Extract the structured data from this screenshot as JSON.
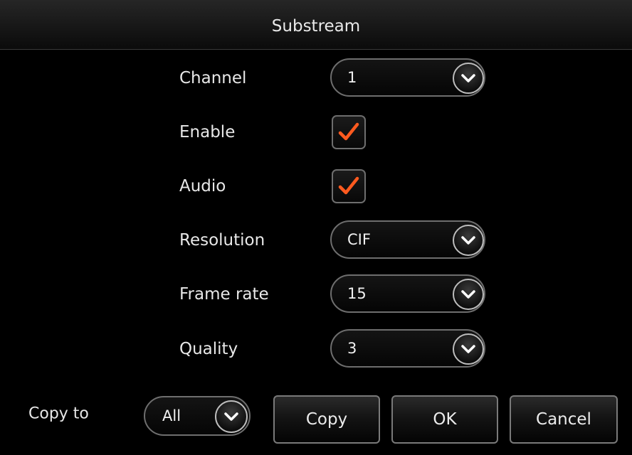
{
  "dialog": {
    "title": "Substream"
  },
  "fields": {
    "channel": {
      "label": "Channel",
      "value": "1"
    },
    "enable": {
      "label": "Enable",
      "checked": true
    },
    "audio": {
      "label": "Audio",
      "checked": true
    },
    "resolution": {
      "label": "Resolution",
      "value": "CIF"
    },
    "frame_rate": {
      "label": "Frame rate",
      "value": "15"
    },
    "quality": {
      "label": "Quality",
      "value": "3"
    }
  },
  "footer": {
    "copy_to_label": "Copy to",
    "copy_to_value": "All",
    "copy_label": "Copy",
    "ok_label": "OK",
    "cancel_label": "Cancel"
  },
  "colors": {
    "checkmark": "#ff5a1f",
    "background": "#000000"
  },
  "icons": {
    "dropdown": "chevron-down-icon",
    "checkbox": "checkmark-icon"
  }
}
